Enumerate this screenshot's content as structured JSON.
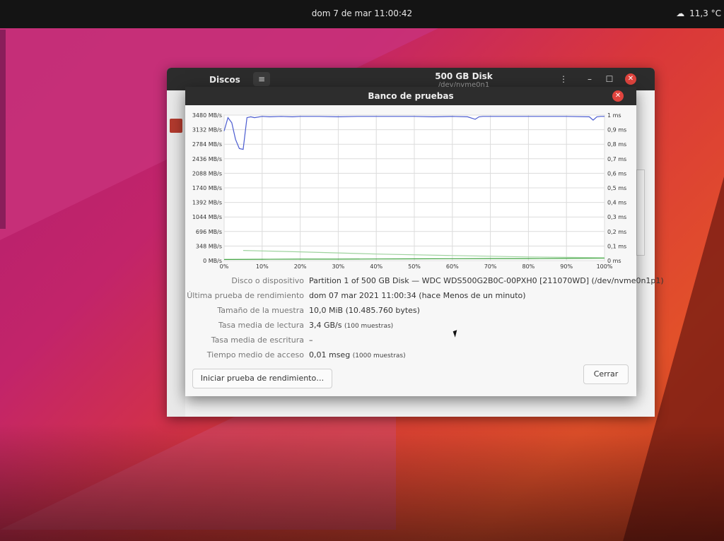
{
  "topbar": {
    "clock": "dom  7 de mar  11:00:42",
    "weather": "11,3 °C",
    "weather_icon": "weather-icon"
  },
  "disks_window": {
    "app_name": "Discos",
    "menu_icon": "≡",
    "title": "500 GB Disk",
    "subtitle": "/dev/nvme0n1",
    "kebab_icon": "⋮",
    "minimize_icon": "–",
    "maximize_icon": "☐",
    "close_icon": "✕"
  },
  "dialog": {
    "title": "Banco de pruebas",
    "close_icon": "✕",
    "start_button": "Iniciar prueba de rendimiento…",
    "close_button": "Cerrar",
    "rows": [
      {
        "label": "Disco o dispositivo",
        "value": "Partition 1 of 500 GB Disk — WDC WDS500G2B0C-00PXH0 [211070WD] (/dev/nvme0n1p1)",
        "small": ""
      },
      {
        "label": "Última prueba de rendimiento",
        "value": "dom 07 mar 2021 11:00:34 (hace Menos de un minuto)",
        "small": ""
      },
      {
        "label": "Tamaño de la muestra",
        "value": "10,0 MiB (10.485.760 bytes)",
        "small": ""
      },
      {
        "label": "Tasa media de lectura",
        "value": "3,4 GB/s",
        "small": "(100 muestras)"
      },
      {
        "label": "Tasa media de escritura",
        "value": "–",
        "small": ""
      },
      {
        "label": "Tiempo medio de acceso",
        "value": "0,01 mseg",
        "small": "(1000 muestras)"
      }
    ]
  },
  "chart_data": {
    "type": "line",
    "left_axis_ticks": [
      "0 MB/s",
      "348 MB/s",
      "696 MB/s",
      "1044 MB/s",
      "1392 MB/s",
      "1740 MB/s",
      "2088 MB/s",
      "2436 MB/s",
      "2784 MB/s",
      "3132 MB/s",
      "3480 MB/s"
    ],
    "right_axis_ticks": [
      "0 ms",
      "0,1 ms",
      "0,2 ms",
      "0,3 ms",
      "0,4 ms",
      "0,5 ms",
      "0,6 ms",
      "0,7 ms",
      "0,8 ms",
      "0,9 ms",
      "1 ms"
    ],
    "x_ticks": [
      "0%",
      "10%",
      "20%",
      "30%",
      "40%",
      "50%",
      "60%",
      "70%",
      "80%",
      "90%",
      "100%"
    ],
    "ylim_left": [
      0,
      3480
    ],
    "ylim_right": [
      0,
      1
    ],
    "grid": true,
    "series": [
      {
        "kind": "read-rate",
        "color": "#4a5bd0",
        "unit": "MB/s",
        "x": [
          0,
          1,
          2,
          3,
          4,
          5,
          6,
          7,
          8,
          10,
          12,
          15,
          18,
          20,
          25,
          30,
          35,
          40,
          45,
          50,
          55,
          60,
          64,
          66,
          67,
          68,
          70,
          75,
          80,
          85,
          90,
          96,
          97,
          98,
          99,
          100
        ],
        "y": [
          3100,
          3420,
          3300,
          2900,
          2680,
          2660,
          3420,
          3440,
          3420,
          3450,
          3440,
          3450,
          3440,
          3450,
          3450,
          3440,
          3450,
          3450,
          3450,
          3450,
          3440,
          3450,
          3440,
          3380,
          3440,
          3450,
          3450,
          3450,
          3450,
          3450,
          3450,
          3440,
          3360,
          3440,
          3450,
          3450
        ]
      },
      {
        "kind": "access-time",
        "color": "#3fa33f",
        "unit": "ms",
        "x": [
          0,
          10,
          20,
          30,
          40,
          50,
          60,
          70,
          80,
          90,
          100
        ],
        "y": [
          0.008,
          0.009,
          0.01,
          0.01,
          0.011,
          0.012,
          0.013,
          0.014,
          0.014,
          0.015,
          0.016
        ]
      },
      {
        "kind": "access-time-faint",
        "color": "#9fd39f",
        "unit": "ms",
        "x": [
          5,
          20,
          40,
          60,
          80,
          100
        ],
        "y": [
          0.07,
          0.06,
          0.045,
          0.035,
          0.025,
          0.02
        ]
      }
    ]
  }
}
